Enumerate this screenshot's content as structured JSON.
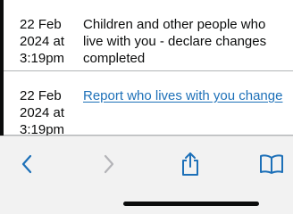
{
  "history": {
    "rows": [
      {
        "date": "22 Feb 2024 at 3:19pm",
        "description": "Children and other people who live with you - declare changes completed"
      },
      {
        "date": "22 Feb 2024 at 3:19pm",
        "description": "Report who lives with you change"
      }
    ]
  },
  "toolbar": {
    "buttons": [
      {
        "icon": "back-chevron-icon",
        "enabled": true
      },
      {
        "icon": "forward-chevron-icon",
        "enabled": false
      },
      {
        "icon": "share-icon",
        "enabled": true
      },
      {
        "icon": "bookmarks-icon",
        "enabled": true
      }
    ],
    "accent_color": "#1d70b8",
    "disabled_color": "#b4b4b8"
  }
}
